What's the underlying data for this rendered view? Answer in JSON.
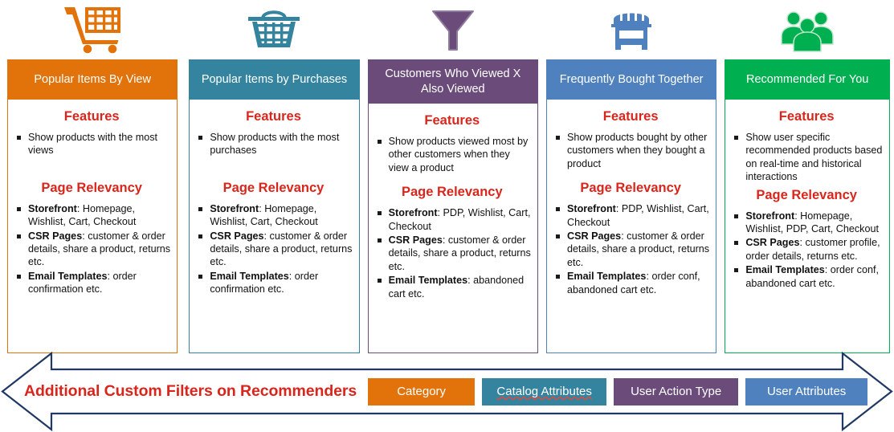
{
  "diagram": {
    "title": "Recommenders overview",
    "colors": {
      "orange": "#E2730B",
      "teal": "#35849F",
      "purple": "#6A4B79",
      "blue": "#4E81BD",
      "green": "#00B050",
      "red_heading": "#D9261C",
      "arrow_outline": "#1F3864"
    },
    "section_labels": {
      "features": "Features",
      "page_relevancy": "Page Relevancy"
    },
    "columns": [
      {
        "icon": "shopping-cart-icon",
        "accent": "#E2730B",
        "title": "Popular Items By View",
        "features": [
          "Show products with the most views"
        ],
        "relevancy": [
          {
            "label": "Storefront",
            "text": ": Homepage, Wishlist, Cart, Checkout"
          },
          {
            "label": "CSR Pages",
            "text": ": customer & order details, share a product, returns etc."
          },
          {
            "label": "Email Templates",
            "text": ": order confirmation etc."
          }
        ]
      },
      {
        "icon": "shopping-basket-icon",
        "accent": "#35849F",
        "title": "Popular Items by Purchases",
        "features": [
          "Show products with the most purchases"
        ],
        "relevancy": [
          {
            "label": "Storefront",
            "text": ": Homepage, Wishlist, Cart, Checkout"
          },
          {
            "label": "CSR Pages",
            "text": ": customer & order details, share a product, returns etc."
          },
          {
            "label": "Email Templates",
            "text": ": order confirmation etc."
          }
        ]
      },
      {
        "icon": "funnel-filter-icon",
        "accent": "#6A4B79",
        "title": "Customers Who Viewed X Also Viewed",
        "features": [
          "Show products viewed most by other customers when they view a product"
        ],
        "relevancy": [
          {
            "label": "Storefront",
            "text": ": PDP, Wishlist, Cart, Checkout"
          },
          {
            "label": "CSR Pages",
            "text": ": customer & order details, share a product, returns etc."
          },
          {
            "label": "Email Templates",
            "text": ": abandoned cart etc."
          }
        ]
      },
      {
        "icon": "storefront-icon",
        "accent": "#4E81BD",
        "title": "Frequently Bought Together",
        "features": [
          "Show products bought by other customers when they bought a product"
        ],
        "relevancy": [
          {
            "label": "Storefront",
            "text": ": PDP, Wishlist, Cart, Checkout"
          },
          {
            "label": "CSR Pages",
            "text": ": customer & order details, share a product, returns etc."
          },
          {
            "label": "Email Templates",
            "text": ": order conf, abandoned cart etc."
          }
        ]
      },
      {
        "icon": "users-group-icon",
        "accent": "#00B050",
        "title": "Recommended For You",
        "features": [
          "Show user specific recommended products based on real-time and historical interactions"
        ],
        "relevancy": [
          {
            "label": "Storefront",
            "text": ": Homepage, Wishlist, PDP, Cart, Checkout"
          },
          {
            "label": "CSR Pages",
            "text": ": customer profile, order details, returns etc."
          },
          {
            "label": "Email Templates",
            "text": ": order conf, abandoned cart etc."
          }
        ]
      }
    ],
    "bottom_band": {
      "title": "Additional Custom Filters on Recommenders",
      "chips": [
        {
          "label": "Category",
          "color": "#E2730B"
        },
        {
          "label": "Catalog Attributes",
          "color": "#35849F"
        },
        {
          "label": "User Action Type",
          "color": "#6A4B79"
        },
        {
          "label": "User Attributes",
          "color": "#4E81BD"
        }
      ]
    }
  }
}
